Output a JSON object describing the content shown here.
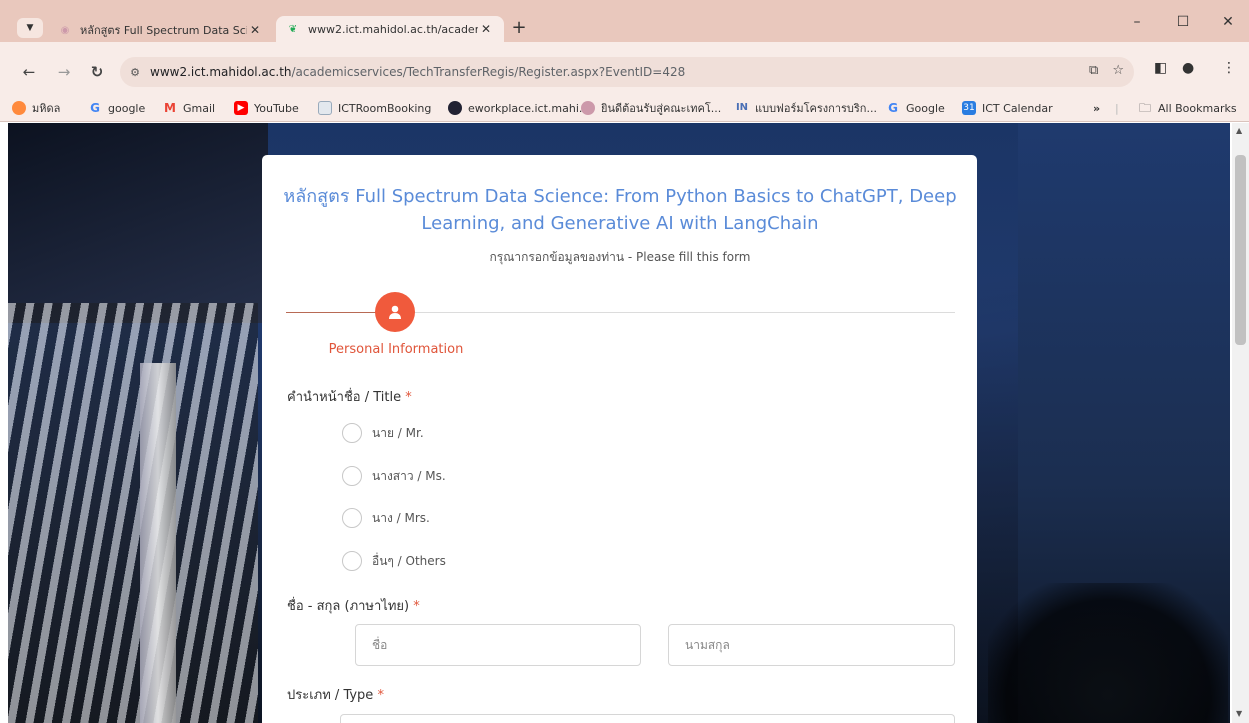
{
  "browser": {
    "tabs": [
      {
        "title": "หลักสูตร Full Spectrum Data Scie",
        "active": false
      },
      {
        "title": "www2.ict.mahidol.ac.th/academ",
        "active": true
      }
    ],
    "url_host": "www2.ict.mahidol.ac.th",
    "url_path": "/academicservices/TechTransferRegis/Register.aspx?EventID=428",
    "bookmarks": [
      {
        "label": "มหิดล",
        "icon": "mahidol-icon",
        "color": "#ff8a3d"
      },
      {
        "label": "google",
        "icon": "google-icon",
        "color": "#4285f4"
      },
      {
        "label": "Gmail",
        "icon": "gmail-icon",
        "color": "#ea4335"
      },
      {
        "label": "YouTube",
        "icon": "youtube-icon",
        "color": "#ff0000"
      },
      {
        "label": "ICTRoomBooking",
        "icon": "page-icon",
        "color": "#9ab"
      },
      {
        "label": "eworkplace.ict.mahi...",
        "icon": "eworkplace-icon",
        "color": "#223"
      },
      {
        "label": "ยินดีต้อนรับสู่คณะเทคโ...",
        "icon": "ict-icon",
        "color": "#c9a"
      },
      {
        "label": "แบบฟอร์มโครงการบริก...",
        "icon": "ict-logo-icon",
        "color": "#4a6fb5"
      },
      {
        "label": "Google",
        "icon": "google-icon",
        "color": "#4285f4"
      },
      {
        "label": "ICT Calendar",
        "icon": "calendar-icon",
        "color": "#2a7de1"
      }
    ],
    "overflow_label": "»",
    "all_bookmarks": "All Bookmarks"
  },
  "form": {
    "course_title": "หลักสูตร Full Spectrum Data Science: From Python Basics to ChatGPT, Deep Learning, and Generative AI with LangChain",
    "subtitle": "กรุณากรอกข้อมูลของท่าน - Please fill this form",
    "step_label": "Personal Information",
    "title_question": "คำนำหน้าชื่อ / Title",
    "title_options": [
      "นาย / Mr.",
      "นางสาว / Ms.",
      "นาง / Mrs.",
      "อื่นๆ / Others"
    ],
    "name_question": "ชื่อ - สกุล (ภาษาไทย)",
    "first_name_placeholder": "ชื่อ",
    "last_name_placeholder": "นามสกุล",
    "type_question": "ประเภท / Type",
    "required_mark": "*"
  }
}
